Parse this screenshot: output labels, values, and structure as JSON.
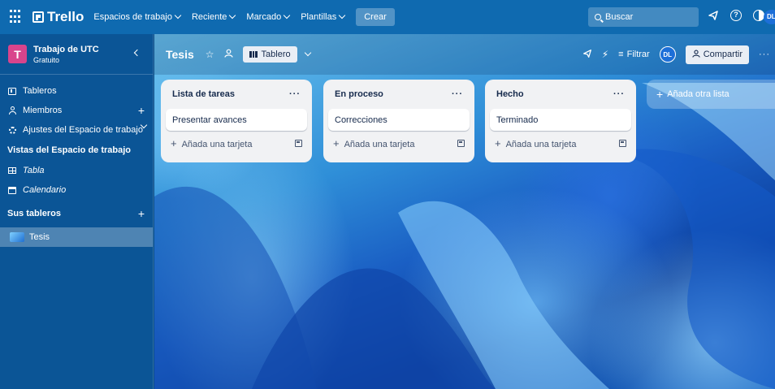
{
  "topnav": {
    "logo_text": "Trello",
    "menu": [
      {
        "label": "Espacios de trabajo"
      },
      {
        "label": "Reciente"
      },
      {
        "label": "Marcado"
      },
      {
        "label": "Plantillas"
      }
    ],
    "create_label": "Crear",
    "search_placeholder": "Buscar",
    "avatar_initials": "DL"
  },
  "sidebar": {
    "workspace_initial": "T",
    "workspace_name": "Trabajo de UTC",
    "workspace_plan": "Gratuito",
    "items": [
      {
        "label": "Tableros",
        "icon": "board-icon"
      },
      {
        "label": "Miembros",
        "icon": "person-icon"
      },
      {
        "label": "Ajustes del Espacio de trabajo",
        "icon": "gear-icon"
      }
    ],
    "views_title": "Vistas del Espacio de trabajo",
    "views": [
      {
        "label": "Tabla",
        "icon": "table-icon"
      },
      {
        "label": "Calendario",
        "icon": "calendar-icon"
      }
    ],
    "boards_title": "Sus tableros",
    "boards": [
      {
        "label": "Tesis"
      }
    ]
  },
  "board": {
    "title": "Tesis",
    "view_label": "Tablero",
    "filter_label": "Filtrar",
    "avatar_initials": "DL",
    "share_label": "Compartir",
    "lists": [
      {
        "title": "Lista de tareas",
        "cards": [
          "Presentar avances"
        ],
        "add_label": "Añada una tarjeta"
      },
      {
        "title": "En proceso",
        "cards": [
          "Correcciones"
        ],
        "add_label": "Añada una tarjeta"
      },
      {
        "title": "Hecho",
        "cards": [
          "Terminado"
        ],
        "add_label": "Añada una tarjeta"
      }
    ],
    "add_list_label": "Añada otra lista"
  }
}
